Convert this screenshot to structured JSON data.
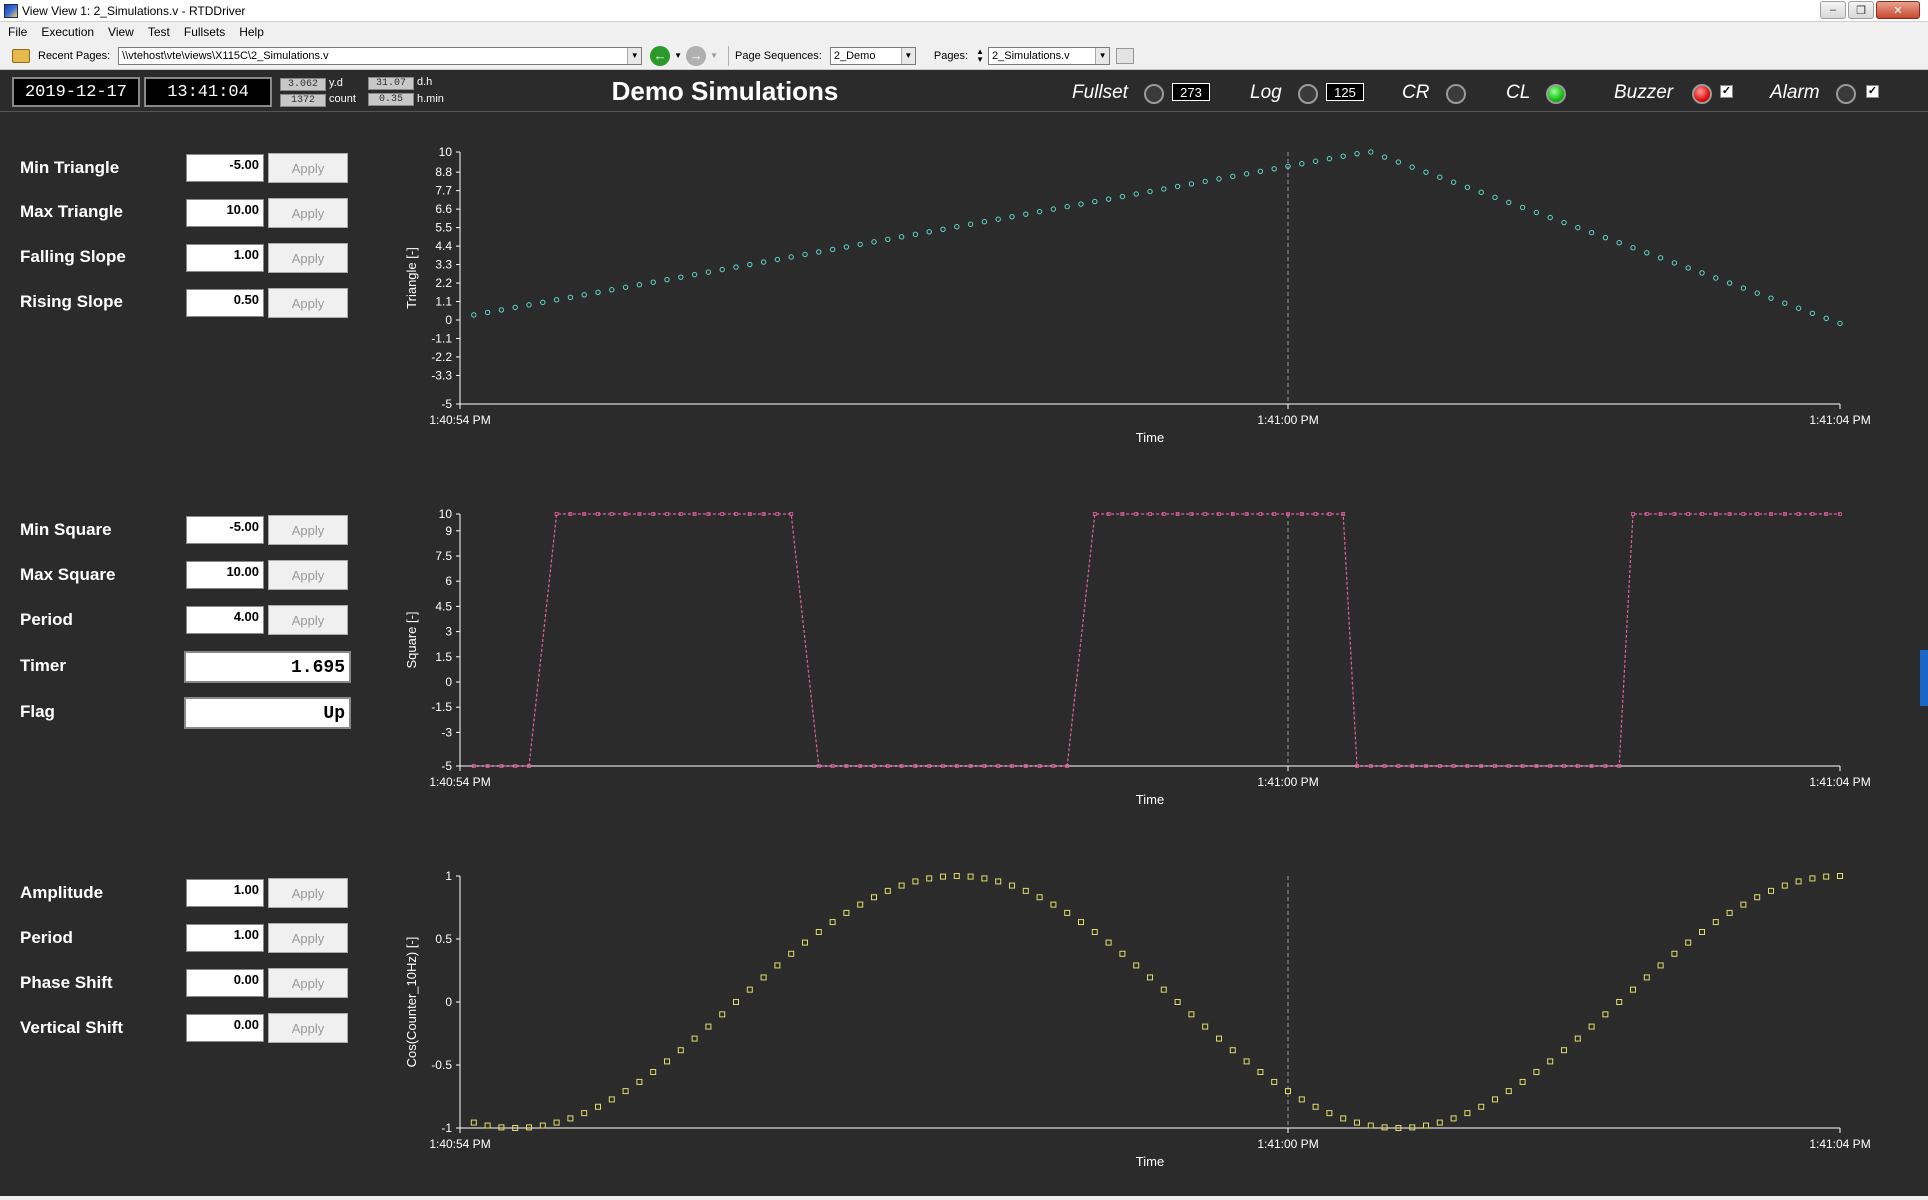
{
  "window": {
    "title": "View View 1: 2_Simulations.v - RTDDriver",
    "min_glyph": "–",
    "max_glyph": "❐",
    "close_glyph": "✕"
  },
  "menu": [
    "File",
    "Execution",
    "View",
    "Test",
    "Fullsets",
    "Help"
  ],
  "toolbar": {
    "recent_label": "Recent Pages:",
    "recent_value": "\\\\vtehost\\vte\\views\\X115C\\2_Simulations.v",
    "seq_label": "Page Sequences:",
    "seq_value": "2_Demo",
    "pages_label": "Pages:",
    "pages_value": "2_Simulations.v"
  },
  "header": {
    "date": "2019-12-17",
    "time": "13:41:04",
    "yd_value": "3.062",
    "yd_unit": "y.d",
    "dh_value": "31.07",
    "dh_unit": "d.h",
    "count_value": "1372",
    "count_unit": "count",
    "hmin_value": "0.35",
    "hmin_unit": "h.min",
    "title": "Demo Simulations",
    "indicators": {
      "fullset": {
        "label": "Fullset",
        "count": "273",
        "state": "off"
      },
      "log": {
        "label": "Log",
        "count": "125",
        "state": "off"
      },
      "cr": {
        "label": "CR",
        "state": "off"
      },
      "cl": {
        "label": "CL",
        "state": "green"
      },
      "buzzer": {
        "label": "Buzzer",
        "state": "red",
        "checked": true
      },
      "alarm": {
        "label": "Alarm",
        "state": "off",
        "checked": true
      }
    },
    "check_glyph": "✓"
  },
  "controls": {
    "triangle": [
      {
        "label": "Min Triangle",
        "value": "-5.00"
      },
      {
        "label": "Max Triangle",
        "value": "10.00"
      },
      {
        "label": "Falling Slope",
        "value": "1.00"
      },
      {
        "label": "Rising Slope",
        "value": "0.50"
      }
    ],
    "square": [
      {
        "label": "Min Square",
        "value": "-5.00"
      },
      {
        "label": "Max Square",
        "value": "10.00"
      },
      {
        "label": "Period",
        "value": "4.00"
      }
    ],
    "timer": {
      "label": "Timer",
      "value": "1.695"
    },
    "flag": {
      "label": "Flag",
      "value": "Up"
    },
    "cosine": [
      {
        "label": "Amplitude",
        "value": "1.00"
      },
      {
        "label": "Period",
        "value": "1.00"
      },
      {
        "label": "Phase Shift",
        "value": "0.00"
      },
      {
        "label": "Vertical Shift",
        "value": "0.00"
      }
    ],
    "apply_label": "Apply"
  },
  "chart_data": [
    {
      "type": "scatter",
      "name": "triangle",
      "color": "#5fd6c8",
      "ylabel": "Triangle [-]",
      "xlabel": "Time",
      "yticks": [
        "10",
        "8.8",
        "7.7",
        "6.6",
        "5.5",
        "4.4",
        "3.3",
        "2.2",
        "1.1",
        "0",
        "-1.1",
        "-2.2",
        "-3.3",
        "-5"
      ],
      "ytick_values": [
        10,
        8.8,
        7.7,
        6.6,
        5.5,
        4.4,
        3.3,
        2.2,
        1.1,
        0,
        -1.1,
        -2.2,
        -3.3,
        -5
      ],
      "ylim": [
        -5,
        10
      ],
      "xlim": [
        0,
        10
      ],
      "xticks": [
        {
          "x": 0,
          "label": "1:40:54 PM"
        },
        {
          "x": 6,
          "label": "1:41:00 PM"
        },
        {
          "x": 10,
          "label": "1:41:04 PM"
        }
      ],
      "cursor_x": 6,
      "shape": "triangle",
      "min": -5,
      "max": 10,
      "rise_rate": 0.5,
      "fall_rate": 1.0,
      "x_start": 0.1,
      "y_start": 0.3,
      "step": 0.1
    },
    {
      "type": "line",
      "name": "square",
      "color": "#e060a0",
      "ylabel": "Square [-]",
      "xlabel": "Time",
      "yticks": [
        "10",
        "9",
        "7.5",
        "6",
        "4.5",
        "3",
        "1.5",
        "0",
        "-1.5",
        "-3",
        "-5"
      ],
      "ytick_values": [
        10,
        9,
        7.5,
        6,
        4.5,
        3,
        1.5,
        0,
        -1.5,
        -3,
        -5
      ],
      "ylim": [
        -5,
        10
      ],
      "xlim": [
        0,
        10
      ],
      "xticks": [
        {
          "x": 0,
          "label": "1:40:54 PM"
        },
        {
          "x": 6,
          "label": "1:41:00 PM"
        },
        {
          "x": 10,
          "label": "1:41:04 PM"
        }
      ],
      "cursor_x": 6,
      "points": [
        [
          0.1,
          -5
        ],
        [
          0.5,
          -5
        ],
        [
          0.7,
          10
        ],
        [
          2.4,
          10
        ],
        [
          2.6,
          -5
        ],
        [
          4.4,
          -5
        ],
        [
          4.6,
          10
        ],
        [
          6.4,
          10
        ],
        [
          6.5,
          -5
        ],
        [
          8.4,
          -5
        ],
        [
          8.5,
          10
        ],
        [
          10,
          10
        ]
      ]
    },
    {
      "type": "scatter",
      "name": "cosine",
      "color": "#e2dc6a",
      "ylabel": "Cos(Counter_10Hz) [-]",
      "xlabel": "Time",
      "yticks": [
        "1",
        "0.5",
        "0",
        "-0.5",
        "-1"
      ],
      "ytick_values": [
        1,
        0.5,
        0,
        -0.5,
        -1
      ],
      "ylim": [
        -1,
        1
      ],
      "xlim": [
        0,
        10
      ],
      "xticks": [
        {
          "x": 0,
          "label": "1:40:54 PM"
        },
        {
          "x": 6,
          "label": "1:41:00 PM"
        },
        {
          "x": 10,
          "label": "1:41:04 PM"
        }
      ],
      "cursor_x": 6,
      "shape": "cosine",
      "cos_period": 6.4,
      "phase_x": 3.6,
      "x_start": 0.1,
      "step": 0.1
    }
  ]
}
